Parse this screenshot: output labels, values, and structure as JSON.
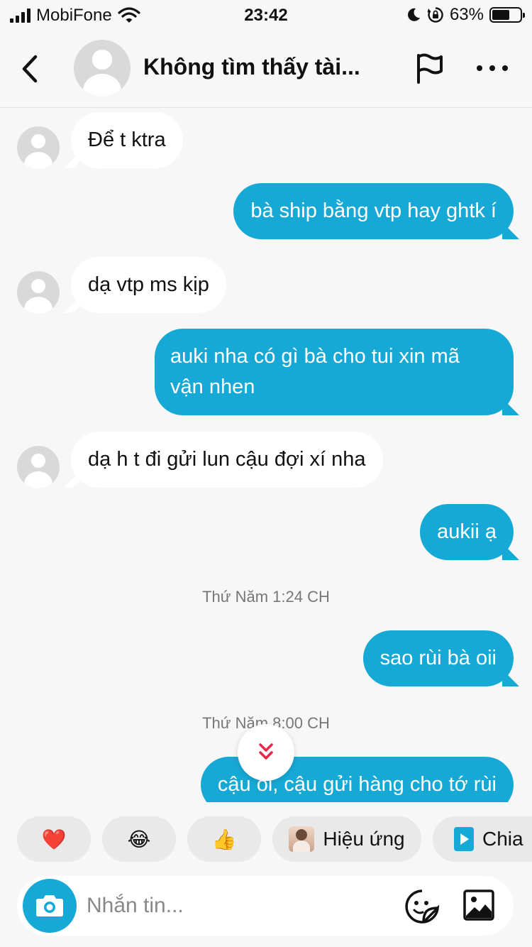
{
  "status_bar": {
    "carrier": "MobiFone",
    "time": "23:42",
    "battery": "63%",
    "battery_level": 0.63,
    "icons": [
      "signal-icon",
      "wifi-icon",
      "moon-icon",
      "rotation-lock-icon",
      "battery-icon"
    ]
  },
  "header": {
    "title": "Không tìm thấy tài...",
    "icons": [
      "back-icon",
      "flag-icon",
      "more-icon"
    ]
  },
  "messages": [
    {
      "side": "in",
      "text": "Để t ktra"
    },
    {
      "side": "out",
      "text": "bà ship bằng vtp hay ghtk í"
    },
    {
      "side": "in",
      "text": "dạ vtp ms kịp"
    },
    {
      "side": "out",
      "text": "auki nha có gì bà cho tui xin mã vận nhen"
    },
    {
      "side": "in",
      "text": "dạ h t đi gửi lun cậu đợi xí nha"
    },
    {
      "side": "out",
      "text": "aukii ạ"
    },
    {
      "side": "timestamp",
      "text": "Thứ Năm 1:24 CH"
    },
    {
      "side": "out",
      "text": "sao rùi bà oii"
    },
    {
      "side": "timestamp",
      "text": "Thứ Năm 8:00 CH"
    },
    {
      "side": "out",
      "text": "cậu oi, cậu gửi hàng cho tớ rùi"
    }
  ],
  "reactions": {
    "heart": "❤️",
    "laugh": "😂",
    "thumbs_up": "👍",
    "effects_label": "Hiệu ứng",
    "share_label": "Chia"
  },
  "compose": {
    "placeholder": "Nhắn tin...",
    "icons": [
      "camera-icon",
      "sticker-icon",
      "gallery-icon"
    ]
  },
  "colors": {
    "outgoing_bubble": "#17a9d6",
    "incoming_bubble": "#ffffff",
    "background": "#f7f7f7",
    "scroll_arrow": "#e8274b"
  }
}
